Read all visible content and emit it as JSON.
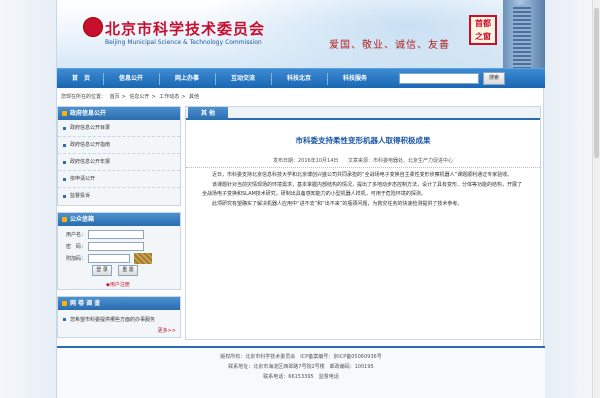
{
  "header": {
    "title_cn": "北京市科学技术委员会",
    "title_en": "Beijing Municipal Science & Technology Commission",
    "slogan": "爱国、敬业、诚信、友善",
    "seal_text": "首都之窗"
  },
  "nav": {
    "items": [
      "首　页",
      "信息公开",
      "网上办事",
      "互动交流",
      "科技北京",
      "科技服务"
    ],
    "search_button": "搜索"
  },
  "breadcrumb": {
    "prefix": "您现在所在的位置：",
    "path": [
      "首页",
      "信息公开",
      "工作动态",
      "其他"
    ]
  },
  "sidebar": {
    "gov_info": {
      "title": "政府信息公开",
      "items": [
        "政府信息公开目录",
        "政府信息公开指南",
        "政府信息公开年报",
        "依申请公开",
        "监督投诉"
      ]
    },
    "mailbox": {
      "title": "公众信箱",
      "username_label": "用户名：",
      "password_label": "密　码：",
      "captcha_label": "附加码：",
      "login_button": "登 录",
      "reset_button": "重 置",
      "register_link": "◆用户注册"
    },
    "survey": {
      "title": "网 卷 调 查",
      "item": "您希望市科委提供哪些方面的办事服务",
      "more": "更多>>"
    }
  },
  "main": {
    "tab_label": "其 他",
    "article": {
      "title": "市科委支持柔性变形机器人取得积极成果",
      "meta": {
        "date": "发布日期：2016年10月14日",
        "source": "文章来源：市科委电器处、北京生产力促进中心"
      },
      "paragraphs": [
        "近日，市科委支持北京信息科技大学和北京博创兴盛公司共同承担的“全战场电子变换自主柔性变形侦察机器人”课题顺利通过专家验收。",
        "该课题针对当前灾情现场的环境需求，基本掌握内部结构的情况，提出了多地动步态控制方法，设计了具有变形、分体等功能的结构，开展了全战场电子变换和SLAM技术研究，研制出具备感知能力的小型机器人样机，可用于危险环境的探测。",
        "此项研究有望确实了解决机器人应用中“进不去”和“出不来”的瓶颈问题，为救灾任务的快速检测提供了技术参考。"
      ]
    }
  },
  "footer": {
    "line1": "版权所有：北京市科学技术委员会　ICP备案编号：京ICP备05060936号",
    "line2": "联系地址：北京市海淀区西翠路7号院2号楼　邮政编码：100195",
    "line3": "联系电话：66153395　监督电话"
  }
}
